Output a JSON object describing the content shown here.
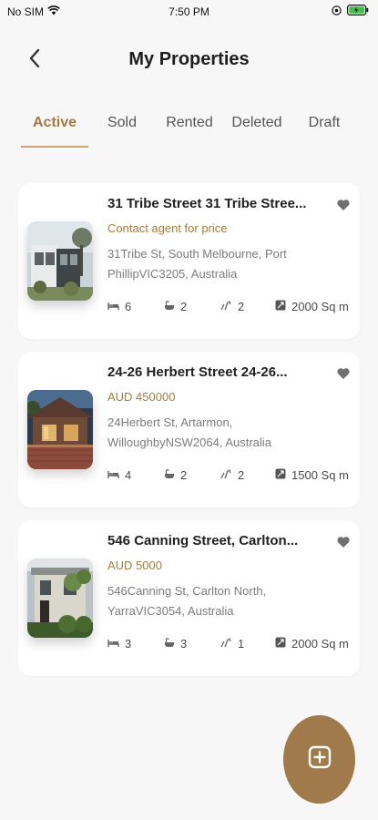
{
  "status_bar": {
    "carrier": "No SIM",
    "time": "7:50 PM"
  },
  "header": {
    "title": "My Properties",
    "back_icon": "chevron-left-icon"
  },
  "tabs": [
    {
      "label": "Active",
      "active": true
    },
    {
      "label": "Sold",
      "active": false
    },
    {
      "label": "Rented",
      "active": false
    },
    {
      "label": "Deleted",
      "active": false
    },
    {
      "label": "Draft",
      "active": false
    }
  ],
  "properties": [
    {
      "title": "31 Tribe Street 31 Tribe Stree...",
      "price": "Contact agent for price",
      "address_line1": "31Tribe St, South Melbourne, Port",
      "address_line2": "PhillipVIC3205, Australia",
      "beds": "6",
      "baths": "2",
      "parking": "2",
      "area": "2000 Sq m"
    },
    {
      "title": "24-26 Herbert Street 24-26...",
      "price": "AUD 450000",
      "address_line1": "24Herbert St, Artarmon,",
      "address_line2": "WilloughbyNSW2064, Australia",
      "beds": "4",
      "baths": "2",
      "parking": "2",
      "area": "1500 Sq m"
    },
    {
      "title": "546 Canning Street, Carlton...",
      "price": "AUD 5000",
      "address_line1": "546Canning St, Carlton North,",
      "address_line2": "YarraVIC3054, Australia",
      "beds": "3",
      "baths": "3",
      "parking": "1",
      "area": "2000 Sq m"
    }
  ],
  "colors": {
    "accent": "#a27a45",
    "fab": "#a07a4b",
    "background": "#f7f7f7"
  },
  "fab": {
    "icon": "add-square-icon"
  }
}
